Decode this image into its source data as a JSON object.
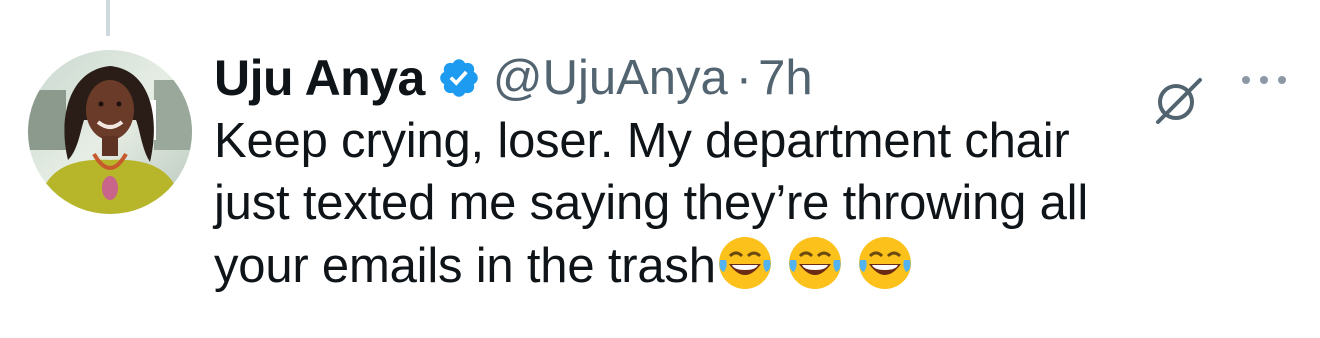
{
  "tweet": {
    "author_name": "Uju Anya",
    "handle": "@UjuAnya",
    "separator": "·",
    "time": "7h",
    "text_lines": [
      "Keep crying, loser. My department chair",
      "just texted me saying they’re throwing all",
      "your emails in the trash"
    ],
    "emojis": [
      "face-with-tears-of-joy",
      "face-with-tears-of-joy",
      "face-with-tears-of-joy"
    ],
    "verified": true
  },
  "icons": {
    "verified": "verified-badge-icon",
    "grok": "grok-icon",
    "more": "more-options-icon"
  },
  "colors": {
    "verified_blue": "#1d9bf0",
    "text_primary": "#0f1419",
    "text_secondary": "#536471",
    "thread_line": "#cfd9de"
  }
}
